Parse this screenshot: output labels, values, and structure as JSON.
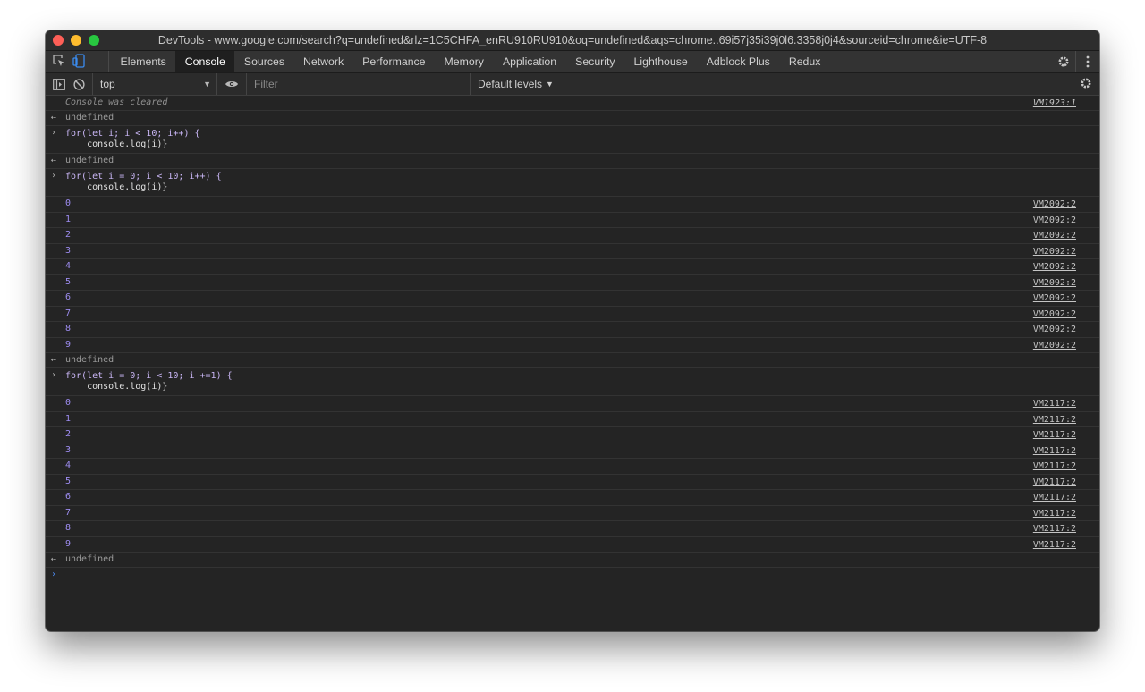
{
  "window": {
    "title": "DevTools - www.google.com/search?q=undefined&rlz=1C5CHFA_enRU910RU910&oq=undefined&aqs=chrome..69i57j35i39j0l6.3358j0j4&sourceid=chrome&ie=UTF-8"
  },
  "tabs": [
    {
      "label": "Elements"
    },
    {
      "label": "Console"
    },
    {
      "label": "Sources"
    },
    {
      "label": "Network"
    },
    {
      "label": "Performance"
    },
    {
      "label": "Memory"
    },
    {
      "label": "Application"
    },
    {
      "label": "Security"
    },
    {
      "label": "Lighthouse"
    },
    {
      "label": "Adblock Plus"
    },
    {
      "label": "Redux"
    }
  ],
  "active_tab": "Console",
  "toolbar": {
    "context": "top",
    "filter_placeholder": "Filter",
    "levels": "Default levels"
  },
  "console": {
    "cleared": {
      "text": "Console was cleared",
      "source": "VM1923:1"
    },
    "result_undefined": "undefined",
    "cmd1": {
      "line1": "for(let i; i < 10; i++) {",
      "line2": "    console.log(i)}"
    },
    "cmd2": {
      "line1": "for(let i = 0; i < 10; i++) {",
      "line2": "    console.log(i)}"
    },
    "cmd3": {
      "line1": "for(let i = 0; i < 10; i +=1) {",
      "line2": "    console.log(i)}"
    },
    "logs1": [
      {
        "value": "0",
        "source": "VM2092:2"
      },
      {
        "value": "1",
        "source": "VM2092:2"
      },
      {
        "value": "2",
        "source": "VM2092:2"
      },
      {
        "value": "3",
        "source": "VM2092:2"
      },
      {
        "value": "4",
        "source": "VM2092:2"
      },
      {
        "value": "5",
        "source": "VM2092:2"
      },
      {
        "value": "6",
        "source": "VM2092:2"
      },
      {
        "value": "7",
        "source": "VM2092:2"
      },
      {
        "value": "8",
        "source": "VM2092:2"
      },
      {
        "value": "9",
        "source": "VM2092:2"
      }
    ],
    "logs2": [
      {
        "value": "0",
        "source": "VM2117:2"
      },
      {
        "value": "1",
        "source": "VM2117:2"
      },
      {
        "value": "2",
        "source": "VM2117:2"
      },
      {
        "value": "3",
        "source": "VM2117:2"
      },
      {
        "value": "4",
        "source": "VM2117:2"
      },
      {
        "value": "5",
        "source": "VM2117:2"
      },
      {
        "value": "6",
        "source": "VM2117:2"
      },
      {
        "value": "7",
        "source": "VM2117:2"
      },
      {
        "value": "8",
        "source": "VM2117:2"
      },
      {
        "value": "9",
        "source": "VM2117:2"
      }
    ]
  },
  "icons": {
    "inspect": "inspect-element-icon",
    "device": "device-toolbar-icon",
    "settings": "gear-icon",
    "more": "kebab-menu-icon",
    "sidebar": "sidebar-toggle-icon",
    "clear": "clear-console-icon",
    "eye": "live-expression-eye-icon"
  },
  "colors": {
    "number": "#9d8cf0",
    "prompt": "#4d8ef7",
    "active_tab_bg": "#1f1f1f"
  }
}
